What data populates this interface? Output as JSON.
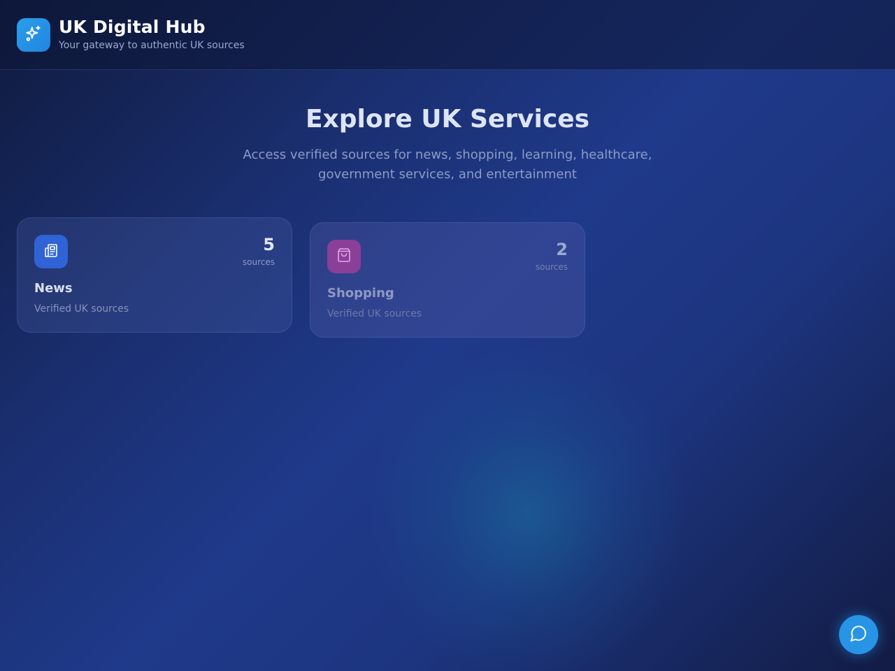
{
  "header": {
    "title": "UK Digital Hub",
    "subtitle": "Your gateway to authentic UK sources",
    "logo_icon": "sparkles-icon"
  },
  "hero": {
    "title": "Explore UK Services",
    "description": "Access verified sources for news, shopping, learning, healthcare, government services, and entertainment"
  },
  "categories": [
    {
      "title": "News",
      "description": "Verified UK sources",
      "count": "5",
      "count_label": "sources",
      "icon": "newspaper-icon",
      "color": "#2f63d6"
    },
    {
      "title": "Shopping",
      "description": "Verified UK sources",
      "count": "2",
      "count_label": "sources",
      "icon": "shopping-bag-icon",
      "color": "#8a3f98"
    }
  ],
  "chat": {
    "icon": "chat-bubble-icon",
    "color": "#2794e6"
  }
}
